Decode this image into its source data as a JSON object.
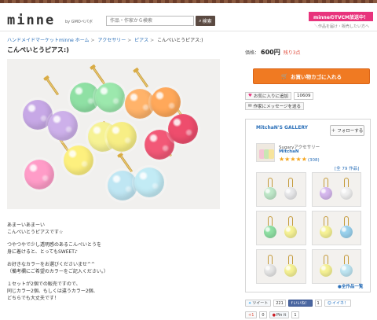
{
  "header": {
    "logo": "minne",
    "logo_by": "by GMOペパボ",
    "search_placeholder": "作品・作家から検索",
    "search_button": "検索",
    "promo": "minneのTVCM放送中！",
    "promo_sub": "＼作品を届け・販売したい方へ"
  },
  "breadcrumb": [
    "ハンドメイドマーケットminne ホーム",
    "アクセサリー",
    "ピアス",
    "こんぺいとうピアス:)"
  ],
  "product": {
    "title": "こんぺいとうピアス:)",
    "price_label": "価格：",
    "price": "600円",
    "stock": "残り3点",
    "cart_button": "お買い物カゴに入れる",
    "fav_button": "お気に入りに追加",
    "fav_count": "10609",
    "message_button": "作家にメッセージを送る"
  },
  "description": [
    "あまーいあまーい\nこんぺいとうピアスです☆",
    "つやつやで少し透明感のあるこんぺいとうを\n身に着けると、とってもSWEET♪",
    "お好きなカラーをお選びくださいませ^^\n（備考欄にご希望のカラーをご記入ください。）",
    "１セットが2個での販売ですので、\n同じカラー2個、もしくは違うカラー2個、\nどちらでも大丈夫です！"
  ],
  "gallery": {
    "name": "MitchaN'S GALLERY",
    "follow": "フォローする",
    "shop_sub": "Sugaryアクセサリー",
    "shop_name": "MitchaN",
    "stars": "★★★★★",
    "rating": "(308)",
    "all_count": "[全 79 作品]",
    "all_link": "全作品一覧",
    "rating_value": 5
  },
  "social": {
    "tweet": "ツイート",
    "tweet_count": "221",
    "like": "いいね！",
    "like_count": "1",
    "hatena": "イイネ！",
    "gplus": "+1",
    "gplus_count": "0",
    "pin": "Pin it",
    "pin_count": "1"
  },
  "colors": {
    "accent_orange": "#f07a22",
    "promo_pink": "#e8337c",
    "link_blue": "#2a6fb8"
  }
}
